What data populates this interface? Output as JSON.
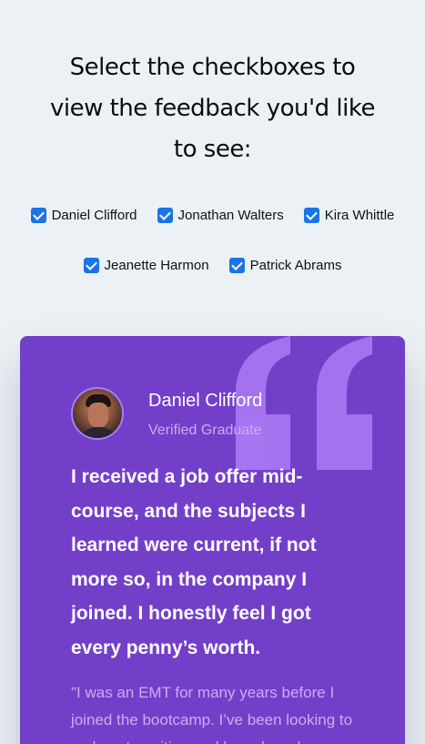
{
  "heading": "Select the checkboxes to view the feedback you'd like to see:",
  "filters": [
    {
      "label": "Daniel Clifford",
      "checked": true
    },
    {
      "label": "Jonathan Walters",
      "checked": true
    },
    {
      "label": "Kira Whittle",
      "checked": true
    },
    {
      "label": "Jeanette Harmon",
      "checked": true
    },
    {
      "label": "Patrick Abrams",
      "checked": true
    }
  ],
  "testimonial": {
    "name": "Daniel Clifford",
    "role": "Verified Graduate",
    "headline": "I received a job offer mid-course, and the subjects I learned were current, if not more so, in the company I joined. I honestly feel I got every penny’s worth.",
    "body": "\"I was an EMT for many years before I joined the bootcamp. I’ve been looking to make a transition and have heard",
    "avatar_icon": "person-photo",
    "quote_icon": "quotation-mark-icon"
  },
  "colors": {
    "background": "#ecf1f5",
    "card": "#733fc8",
    "checkbox": "#1a73e8",
    "quote_mark": "#a775f1",
    "muted_text": "#c9aef2"
  }
}
